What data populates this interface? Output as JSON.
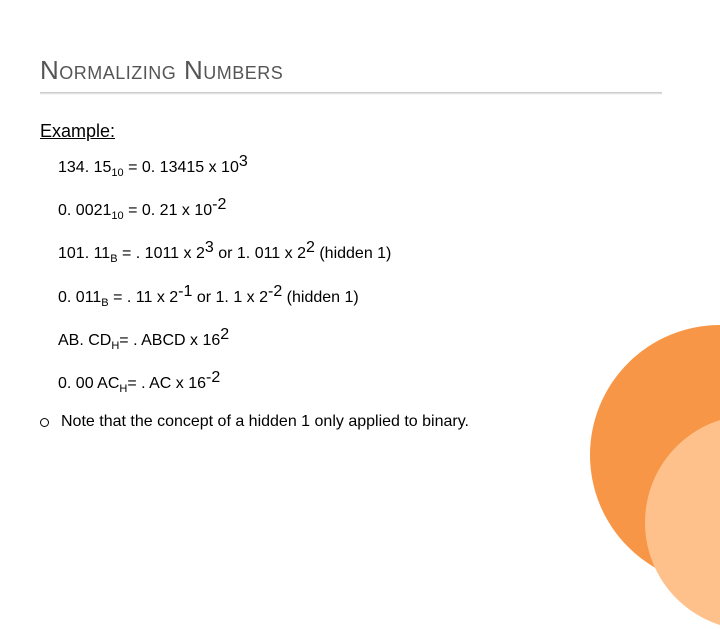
{
  "title": "Normalizing Numbers",
  "exampleLabel": "Example:",
  "eq1": {
    "mant": "134. 15",
    "sub": "10",
    "rhs": " = 0. 13415 x 10",
    "exp": "3"
  },
  "eq2": {
    "mant": "0. 0021",
    "sub": "10",
    "rhs": " =  0. 21 x 10",
    "exp": "-2"
  },
  "eq3": {
    "mant": "101. 11",
    "sub": "B",
    "rhs": " = . 1011 x 2",
    "exp": "3",
    "or": " or 1. 011 x 2",
    "exp2": "2",
    "tail": "  (hidden 1)"
  },
  "eq4": {
    "mant": "0. 011",
    "sub": "B",
    "rhs": " = . 11 x 2",
    "exp": "-1",
    "or": " or 1. 1 x 2",
    "exp2": "-2",
    "tail": "  (hidden 1)"
  },
  "eq5": {
    "mant": "AB. CD",
    "sub": "H",
    "rhs": "= . ABCD x 16",
    "exp": "2"
  },
  "eq6": {
    "mant": "0. 00 AC",
    "sub": "H",
    "rhs": "= . AC x 16",
    "exp": "-2"
  },
  "note": "Note that the concept of a hidden 1 only applied to binary."
}
